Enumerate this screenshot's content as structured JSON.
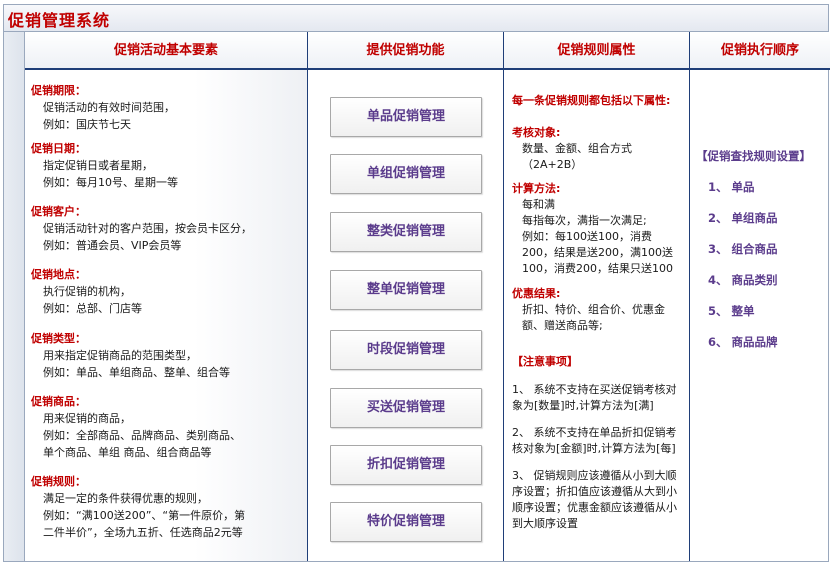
{
  "app": {
    "title": "促销管理系统"
  },
  "columns": {
    "basic": "促销活动基本要素",
    "functions": "提供促销功能",
    "rules": "促销规则属性",
    "order": "促销执行顺序"
  },
  "elements": [
    {
      "title": "促销期限：",
      "lines": [
        "促销活动的有效时间范围，",
        "例如：国庆节七天"
      ]
    },
    {
      "title": "促销日期：",
      "lines": [
        "指定促销日或者星期，",
        "例如：每月10号、星期一等"
      ]
    },
    {
      "title": "促销客户：",
      "lines": [
        "促销活动针对的客户范围，按会员卡区分，",
        "例如：普通会员、VIP会员等"
      ]
    },
    {
      "title": "促销地点：",
      "lines": [
        "执行促销的机构，",
        "例如：总部、门店等"
      ]
    },
    {
      "title": "促销类型：",
      "lines": [
        "用来指定促销商品的范围类型，",
        "例如：单品、单组商品、整单、组合等"
      ]
    },
    {
      "title": "促销商品：",
      "lines": [
        "用来促销的商品，",
        "例如：全部商品、品牌商品、类别商品、",
        "单个商品、单组 商品、组合商品等"
      ]
    },
    {
      "title": "促销规则：",
      "lines": [
        "满足一定的条件获得优惠的规则，",
        "例如：“满100送200”、“第一件原价，第",
        "二件半价”，全场九五折、任选商品2元等"
      ]
    }
  ],
  "functions": [
    "单品促销管理",
    "单组促销管理",
    "整类促销管理",
    "整单促销管理",
    "时段促销管理",
    "买送促销管理",
    "折扣促销管理",
    "特价促销管理"
  ],
  "rules": {
    "intro": "每一条促销规则都包括以下属性:",
    "assess_title": "考核对象:",
    "assess_lines": [
      "数量、金额、组合方式",
      "（2A+2B）"
    ],
    "calc_title": "计算方法:",
    "calc_lines": [
      "每和满",
      "每指每次，满指一次满足;",
      "例如：每100送100，消费",
      "200，结果是送200，满100送",
      "100，消费200，结果只送100"
    ],
    "result_title": "优惠结果:",
    "result_lines": [
      "折扣、特价、组合价、优惠金",
      "额、赠送商品等;"
    ],
    "notice_title": "【注意事项】",
    "notes": [
      [
        "1、 系统不支持在买送促销考核对",
        "象为[数量]时,计算方法为[满]"
      ],
      [
        "2、 系统不支持在单品折扣促销考",
        "核对象为[金额]时,计算方法为[每]"
      ],
      [
        "3、 促销规则应该遵循从小到大顺",
        "序设置；折扣值应该遵循从大到小",
        "顺序设置；优惠金额应该遵循从小",
        "到大顺序设置"
      ]
    ]
  },
  "order": {
    "title": "【促销查找规则设置】",
    "items": [
      "1、 单品",
      "2、 单组商品",
      "3、 组合商品",
      "4、 商品类别",
      "5、 整单",
      "6、 商品品牌"
    ]
  }
}
